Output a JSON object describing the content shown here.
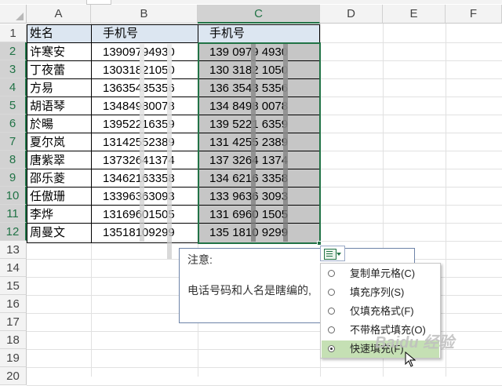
{
  "columns": [
    "A",
    "B",
    "C",
    "D",
    "E",
    "F"
  ],
  "row_numbers": [
    "1",
    "2",
    "3",
    "4",
    "5",
    "6",
    "7",
    "8",
    "9",
    "10",
    "11",
    "12",
    "13",
    "14",
    "15",
    "16",
    "17",
    "18",
    "19",
    "20"
  ],
  "headers": {
    "name": "姓名",
    "phone": "手机号",
    "phone_fmt": "手机号"
  },
  "rows": [
    {
      "name": "许寒安",
      "phone": "13909794930",
      "phone_fmt": "139 0979 4930"
    },
    {
      "name": "丁夜蕾",
      "phone": "13031821050",
      "phone_fmt": "130 3182 1050"
    },
    {
      "name": "方易",
      "phone": "13635435356",
      "phone_fmt": "136 3543 5356"
    },
    {
      "name": "胡语琴",
      "phone": "13484980078",
      "phone_fmt": "134 8498 0078"
    },
    {
      "name": "於暘",
      "phone": "13952216359",
      "phone_fmt": "139 5221 6359"
    },
    {
      "name": "夏尔岚",
      "phone": "13142552389",
      "phone_fmt": "131 4255 2389"
    },
    {
      "name": "唐紫翠",
      "phone": "13732641374",
      "phone_fmt": "137 3264 1374"
    },
    {
      "name": "邵乐菱",
      "phone": "13462163358",
      "phone_fmt": "134 6216 3358"
    },
    {
      "name": "任傲珊",
      "phone": "13396363093",
      "phone_fmt": "133 9636 3093"
    },
    {
      "name": "李烨",
      "phone": "13169601505",
      "phone_fmt": "131 6960 1505"
    },
    {
      "name": "周曼文",
      "phone": "13518109299",
      "phone_fmt": "135 1810 9299"
    }
  ],
  "comment": {
    "title": "注意:",
    "body": "电话号码和人名是瞎编的,"
  },
  "autofill_menu": [
    {
      "label": "复制单元格(C)",
      "selected": false
    },
    {
      "label": "填充序列(S)",
      "selected": false
    },
    {
      "label": "仅填充格式(F)",
      "selected": false
    },
    {
      "label": "不带格式填充(O)",
      "selected": false
    },
    {
      "label": "快速填充(F)",
      "selected": true
    }
  ],
  "watermark": "Baidu 经验",
  "colors": {
    "accent": "#217346",
    "header_fill": "#dce6f1",
    "formatted_fill": "#c6c6c6",
    "menu_highlight": "#c5e0b4"
  }
}
